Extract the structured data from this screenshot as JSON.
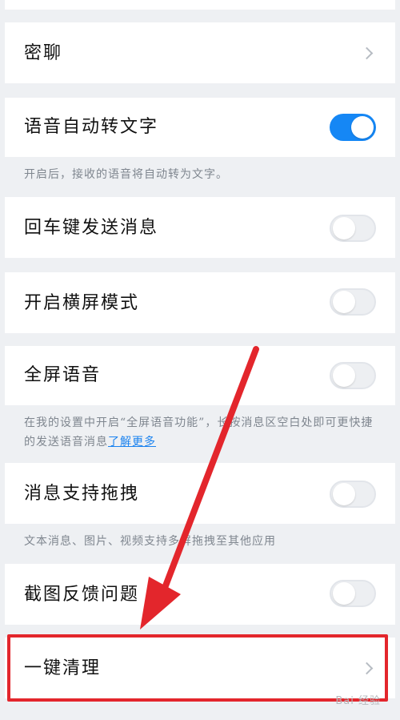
{
  "settings": {
    "secret_chat": {
      "label": "密聊"
    },
    "voice_to_text": {
      "label": "语音自动转文字",
      "enabled": true,
      "hint": "开启后，接收的语音将自动转为文字。"
    },
    "enter_to_send": {
      "label": "回车键发送消息",
      "enabled": false
    },
    "landscape_mode": {
      "label": "开启横屏模式",
      "enabled": false
    },
    "fullscreen_voice": {
      "label": "全屏语音",
      "enabled": false,
      "hint": "在我的设置中开启“全屏语音功能”，长按消息区空白处即可更快捷的发送语音消息",
      "link": "了解更多"
    },
    "message_drag": {
      "label": "消息支持拖拽",
      "enabled": false,
      "hint": "文本消息、图片、视频支持多屏拖拽至其他应用"
    },
    "screenshot_feedback": {
      "label": "截图反馈问题",
      "enabled": false
    },
    "one_click_clean": {
      "label": "一键清理"
    }
  },
  "colors": {
    "toggle_on": "#1587f5",
    "annotation_red": "#e3262c"
  },
  "icons": {
    "row_chevron": "chevron-right-icon",
    "annotation_arrow": "arrow-icon"
  },
  "watermark": "Bai 经验"
}
